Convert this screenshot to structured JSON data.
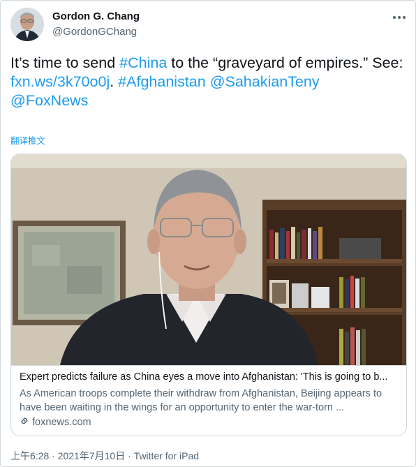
{
  "author": {
    "name": "Gordon G. Chang",
    "handle": "@GordonGChang"
  },
  "tweet": {
    "text_part1": "It’s time to send ",
    "hashtag_china": "#China",
    "text_part2": " to the “graveyard of empires.” See:",
    "link": "fxn.ws/3k70o0j",
    "dot": ".",
    "hashtag_afghanistan": "#Afghanistan",
    "mention_sahakian": "@SahakianTeny",
    "mention_foxnews": "@FoxNews"
  },
  "translate_label": "翻译推文",
  "card": {
    "title": "Expert predicts failure as China eyes a move into Afghanistan: 'This is going to b...",
    "description": "As American troops complete their withdraw from Afghanistan, Beijing appears to have been waiting in the wings for an opportunity to enter the war-torn ...",
    "domain": "foxnews.com"
  },
  "meta": {
    "time": "上午6:28",
    "separator": " · ",
    "date": "2021年7月10日",
    "source": "Twitter for iPad"
  },
  "colors": {
    "link": "#1d9bf0",
    "text": "#0f1419",
    "secondary": "#536471"
  },
  "icons": {
    "more": "more-icon",
    "link": "link-icon"
  }
}
